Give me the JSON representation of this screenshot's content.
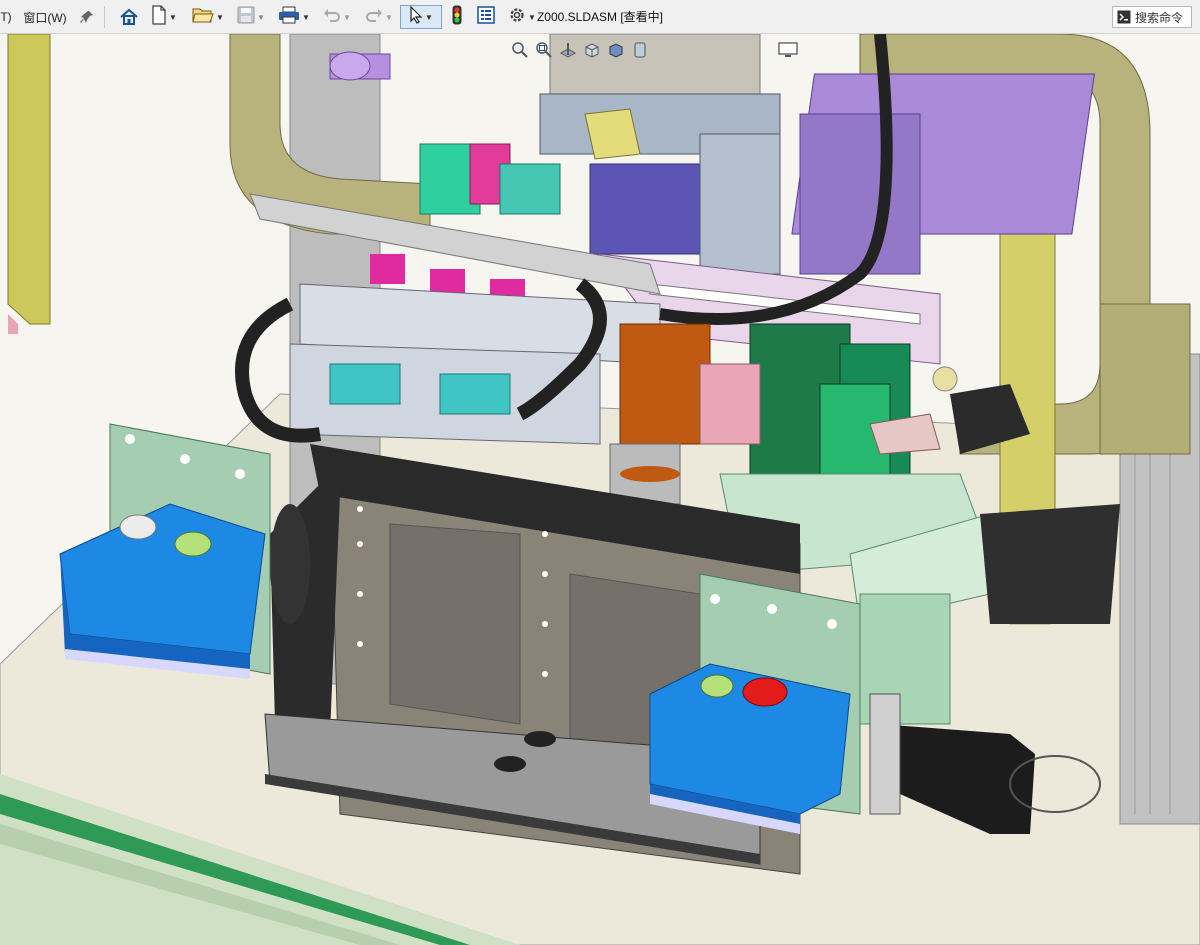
{
  "window": {
    "title": "Z000.SLDASM [查看中]",
    "menu_cut": "T)",
    "menu_window": "窗口(W)"
  },
  "search": {
    "label": "搜索命令"
  },
  "icons": {
    "pin": "pin-icon",
    "home": "home-icon",
    "new": "new-file-icon",
    "open": "open-folder-icon",
    "save": "save-icon",
    "print": "print-icon",
    "undo": "undo-icon",
    "redo": "redo-icon",
    "select": "select-arrow-icon",
    "rebuild": "traffic-light-icon",
    "file_props": "file-properties-icon",
    "options": "gear-icon",
    "search_cmd": "command-search-icon"
  },
  "viewport": {
    "hud_icons": [
      "zoom-to-fit-icon",
      "zoom-area-icon",
      "section-view-icon",
      "view-orientation-icon",
      "display-style-icon",
      "appearance-icon",
      "monitor-icon"
    ],
    "model_name": "Z000.SLDASM"
  },
  "colors": {
    "olive_frame": "#b5b07a",
    "purple": "#a88ad8",
    "blue_box": "#1e88e5",
    "dark_green": "#1f7a4a",
    "mint": "#a8d5b5",
    "gray_plate": "#8a8a8a"
  }
}
